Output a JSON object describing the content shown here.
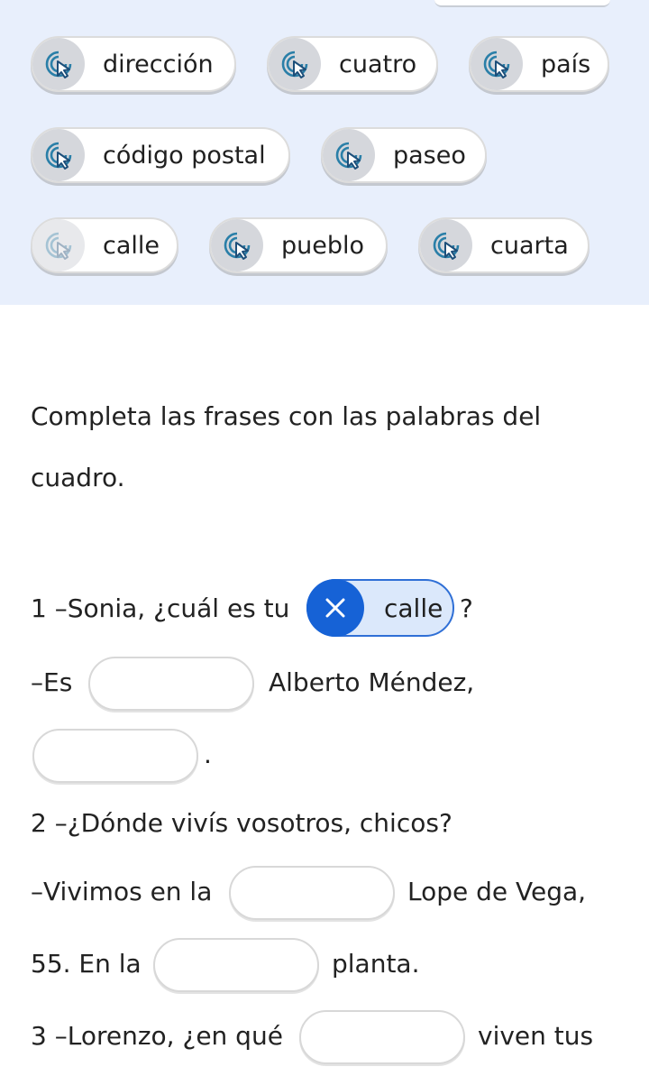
{
  "word_bank": [
    {
      "label": "dirección",
      "used": false
    },
    {
      "label": "cuatro",
      "used": false
    },
    {
      "label": "país",
      "used": false
    },
    {
      "label": "código postal",
      "used": false
    },
    {
      "label": "paseo",
      "used": false
    },
    {
      "label": "calle",
      "used": true
    },
    {
      "label": "pueblo",
      "used": false
    },
    {
      "label": "cuarta",
      "used": false
    }
  ],
  "instructions": "Completa las frases con las palabras del cuadro.",
  "sentences": {
    "s1a_pre": "1 –Sonia, ¿cuál es tu",
    "s1a_answer": "calle",
    "s1a_post": "?",
    "s1b_pre": "–Es",
    "s1b_post": "Alberto Méndez,",
    "s1c_post": ".",
    "s2a": "2 –¿Dónde vivís vosotros, chicos?",
    "s2b_pre": "–Vivimos en la",
    "s2b_post": "Lope de Vega,",
    "s2c_pre": "55. En la",
    "s2c_post": "planta.",
    "s3_pre": "3 –Lorenzo, ¿en qué",
    "s3_post": "viven tus"
  },
  "colors": {
    "accent": "#1662d6",
    "word_bank_bg": "#e8effc",
    "filled_bg": "#dbe8fb"
  },
  "icons": {
    "chip": "tap-cursor-icon",
    "remove": "close-icon"
  }
}
